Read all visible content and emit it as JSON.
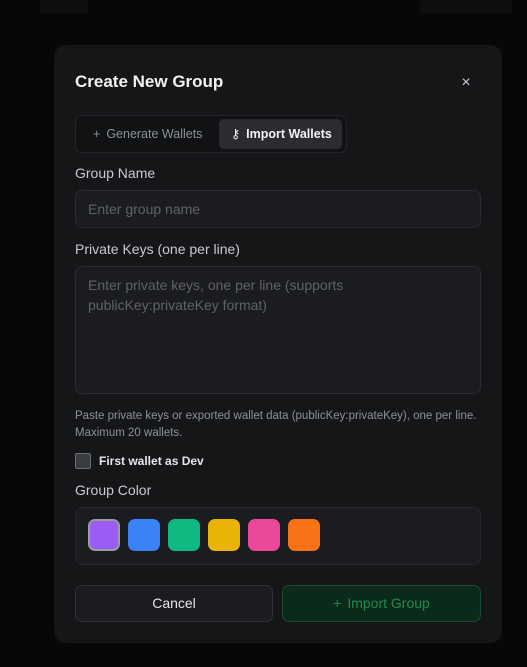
{
  "modal": {
    "title": "Create New Group",
    "close_icon": "×"
  },
  "tabs": [
    {
      "icon": "+",
      "icon_name": "plus-icon",
      "label": "Generate Wallets",
      "active": false
    },
    {
      "icon": "⚷",
      "icon_name": "key-icon",
      "label": "Import Wallets",
      "active": true
    }
  ],
  "group_name": {
    "label": "Group Name",
    "value": "",
    "placeholder": "Enter group name"
  },
  "private_keys": {
    "label": "Private Keys (one per line)",
    "value": "",
    "placeholder": "Enter private keys, one per line (supports publicKey:privateKey format)",
    "help": "Paste private keys or exported wallet data (publicKey:privateKey), one per line. Maximum 20 wallets."
  },
  "dev_checkbox": {
    "label": "First wallet as Dev",
    "checked": false
  },
  "group_color": {
    "label": "Group Color",
    "options": [
      "#9b5cf6",
      "#3b82f6",
      "#10b981",
      "#eab308",
      "#ec4899",
      "#f97316"
    ],
    "selected_index": 0
  },
  "actions": {
    "cancel_label": "Cancel",
    "submit_icon": "+",
    "submit_label": "Import Group"
  }
}
